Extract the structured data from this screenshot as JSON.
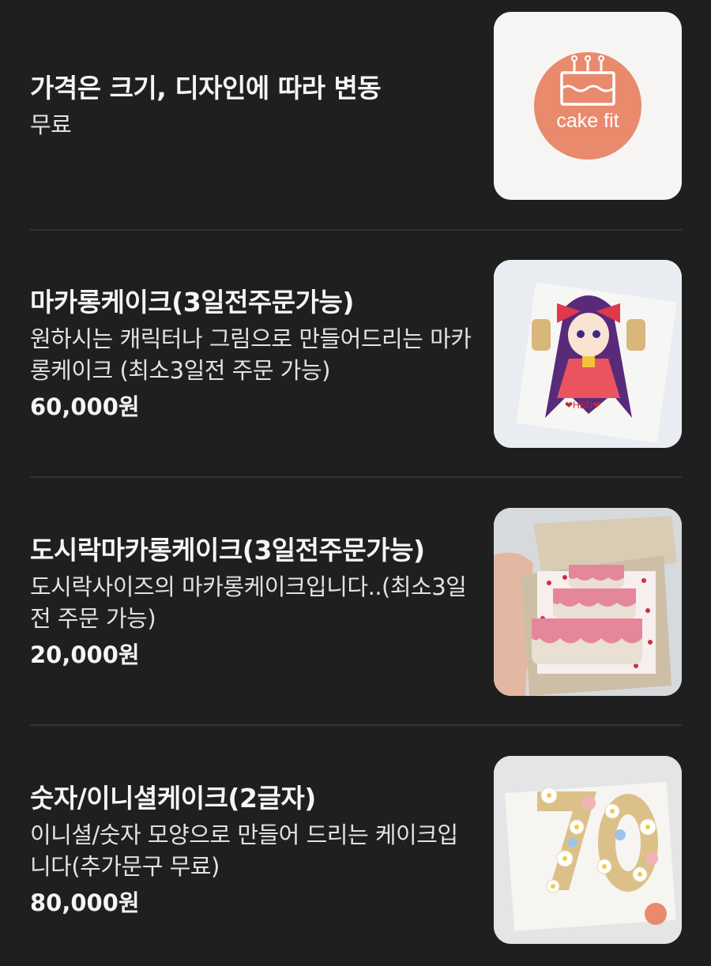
{
  "menu": {
    "items": [
      {
        "title": "가격은 크기, 디자인에 따라 변동",
        "description": "무료",
        "price": "",
        "image": "cake-fit-logo",
        "logo_text": "cake fit",
        "colors": {
          "logo_circle": "#e98a6d",
          "logo_bg": "#f7f5f4"
        }
      },
      {
        "title": "마카롱케이크(3일전주문가능)",
        "description": "원하시는 캐릭터나 그림으로 만들어드리는 마카롱케이크 (최소3일전 주문 가능)",
        "price": "60,000원",
        "image": "character-macaron-cake-photo"
      },
      {
        "title": "도시락마카롱케이크(3일전주문가능)",
        "description": "도시락사이즈의 마카롱케이크입니다..(최소3일전 주문 가능)",
        "price": "20,000원",
        "image": "lunchbox-macaron-cake-photo"
      },
      {
        "title": "숫자/이니셜케이크(2글자)",
        "description": "이니셜/숫자 모양으로 만들어 드리는 케이크입니다(추가문구 무료)",
        "price": "80,000원",
        "image": "number-initial-cake-photo"
      }
    ]
  }
}
